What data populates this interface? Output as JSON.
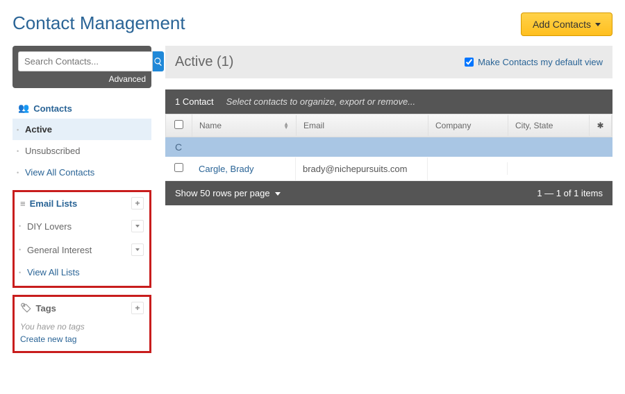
{
  "header": {
    "title": "Contact Management",
    "add_button": "Add Contacts"
  },
  "search": {
    "placeholder": "Search Contacts...",
    "advanced": "Advanced"
  },
  "nav": {
    "contacts": {
      "label": "Contacts",
      "items": [
        {
          "label": "Active",
          "active": true
        },
        {
          "label": "Unsubscribed"
        },
        {
          "label": "View All Contacts",
          "link": true
        }
      ]
    },
    "email_lists": {
      "label": "Email Lists",
      "items": [
        {
          "label": "DIY Lovers"
        },
        {
          "label": "General Interest"
        },
        {
          "label": "View All Lists",
          "link": true
        }
      ]
    },
    "tags": {
      "label": "Tags",
      "empty_text": "You have no tags",
      "create_text": "Create new tag"
    }
  },
  "main": {
    "panel_title": "Active (1)",
    "default_view": "Make Contacts my default view",
    "toolbar": {
      "count_label": "1 Contact",
      "hint": "Select contacts to organize, export or remove..."
    },
    "columns": {
      "name": "Name",
      "email": "Email",
      "company": "Company",
      "city": "City, State"
    },
    "letter": "C",
    "rows": [
      {
        "name": "Cargle, Brady",
        "email": "brady@nichepursuits.com",
        "company": "",
        "city": ""
      }
    ],
    "footer": {
      "rows_per_page": "Show 50 rows per page",
      "pagination": "1 — 1 of 1 items"
    }
  }
}
